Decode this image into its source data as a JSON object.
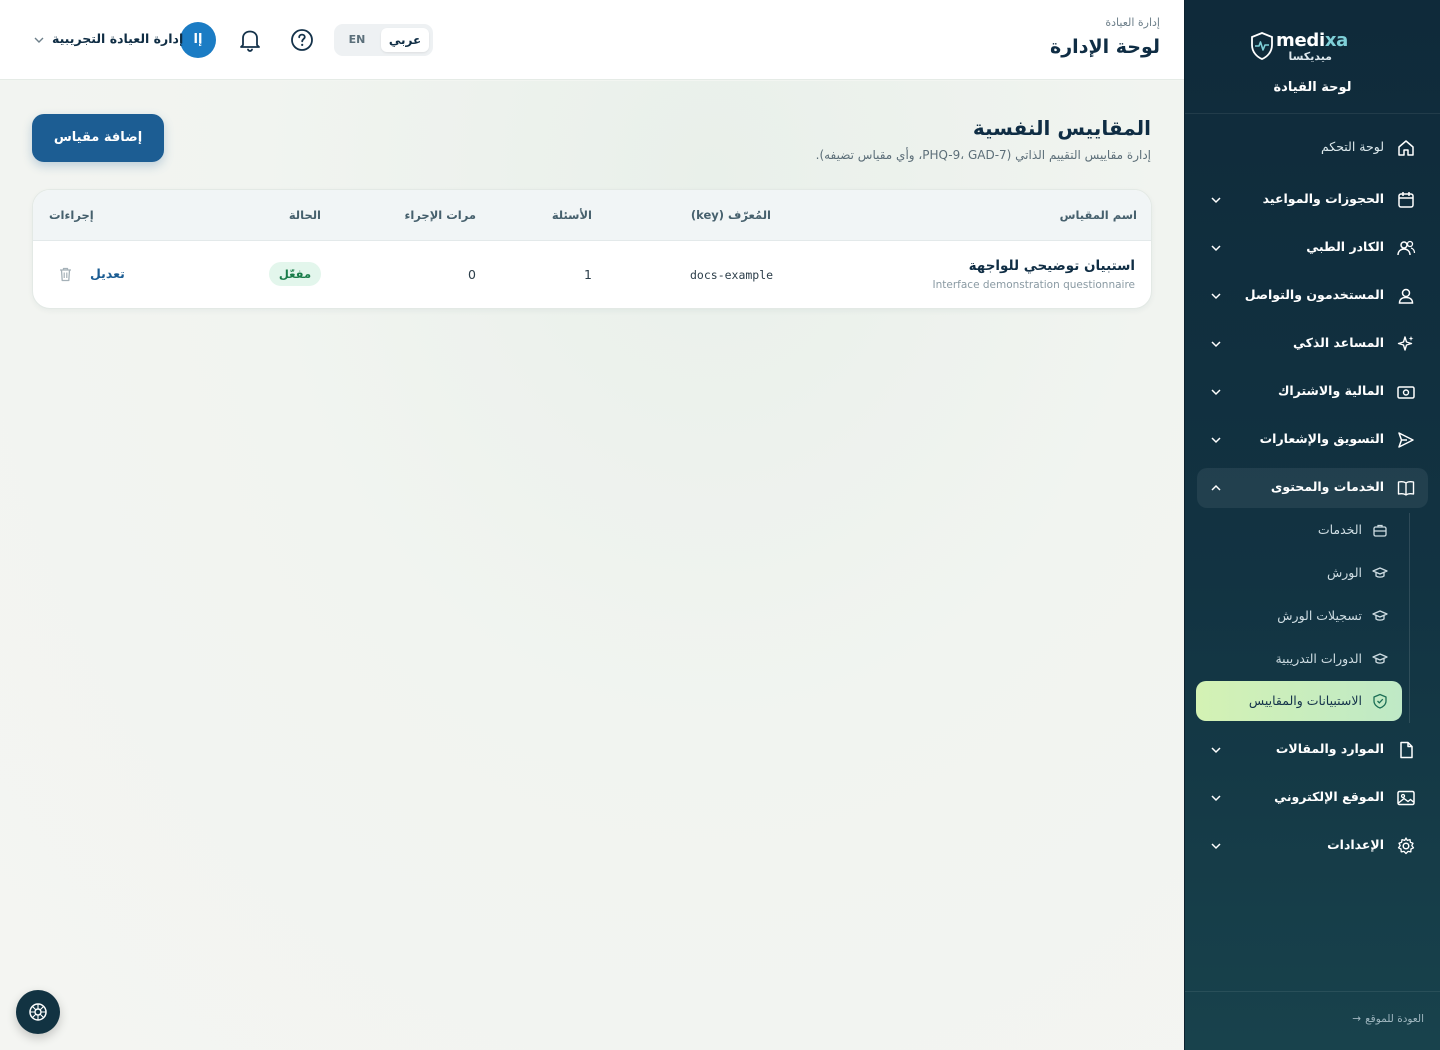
{
  "brand": {
    "name_main": "medi",
    "name_accent": "xa",
    "name_sub": "ميديكسا",
    "dashboard_title": "لوحة القيادة"
  },
  "sidebar": {
    "items": [
      {
        "label": "لوحة التحكم",
        "icon": "home-icon",
        "expandable": false
      },
      {
        "label": "الحجوزات والمواعيد",
        "icon": "calendar-icon",
        "expandable": true
      },
      {
        "label": "الكادر الطبي",
        "icon": "users-icon",
        "expandable": true
      },
      {
        "label": "المستخدمون والتواصل",
        "icon": "user-icon",
        "expandable": true
      },
      {
        "label": "المساعد الذكي",
        "icon": "sparkles-icon",
        "expandable": true
      },
      {
        "label": "المالية والاشتراك",
        "icon": "banknote-icon",
        "expandable": true
      },
      {
        "label": "التسويق والإشعارات",
        "icon": "send-icon",
        "expandable": true
      },
      {
        "label": "الخدمات والمحتوى",
        "icon": "book-icon",
        "expandable": true,
        "open": true
      },
      {
        "label": "الموارد والمقالات",
        "icon": "file-icon",
        "expandable": true
      },
      {
        "label": "الموقع الإلكتروني",
        "icon": "image-icon",
        "expandable": true
      },
      {
        "label": "الإعدادات",
        "icon": "settings-icon",
        "expandable": true
      }
    ],
    "subitems": [
      {
        "label": "الخدمات",
        "icon": "briefcase-icon"
      },
      {
        "label": "الورش",
        "icon": "graduation-cap-icon"
      },
      {
        "label": "تسجيلات الورش",
        "icon": "graduation-cap-icon"
      },
      {
        "label": "الدورات التدريبية",
        "icon": "graduation-cap-icon"
      },
      {
        "label": "الاستبيانات والمقاييس",
        "icon": "shield-check-icon",
        "active": true
      }
    ],
    "back_link": "العودة للموقع"
  },
  "header": {
    "breadcrumb": "إدارة العيادة",
    "title": "لوحة الإدارة",
    "lang_ar": "عربي",
    "lang_en": "EN",
    "avatar_initials": "إا",
    "clinic_name": "إدارة العيادة التجريبية"
  },
  "main": {
    "title": "المقاييس النفسية",
    "subtitle": "إدارة مقاييس التقييم الذاتي (PHQ-9، GAD-7، وأي مقياس تضيفه).",
    "add_button": "إضافة مقياس",
    "table": {
      "headers": {
        "name": "اسم المقياس",
        "key": "المُعرّف (key)",
        "questions": "الأسئلة",
        "runs": "مرات الإجراء",
        "status": "الحالة",
        "actions": "إجراءات"
      },
      "rows": [
        {
          "name": "استبيان توضيحي للواجهة",
          "description": "Interface demonstration questionnaire",
          "key": "docs-example",
          "questions": "1",
          "runs": "0",
          "status": "مفعّل",
          "edit": "تعديل"
        }
      ]
    }
  },
  "colors": {
    "sidebar_bg": "#0f2a3a",
    "primary": "#1c5d93",
    "active_item": "#d4f2b4",
    "status_active": "#1a7d4a"
  }
}
